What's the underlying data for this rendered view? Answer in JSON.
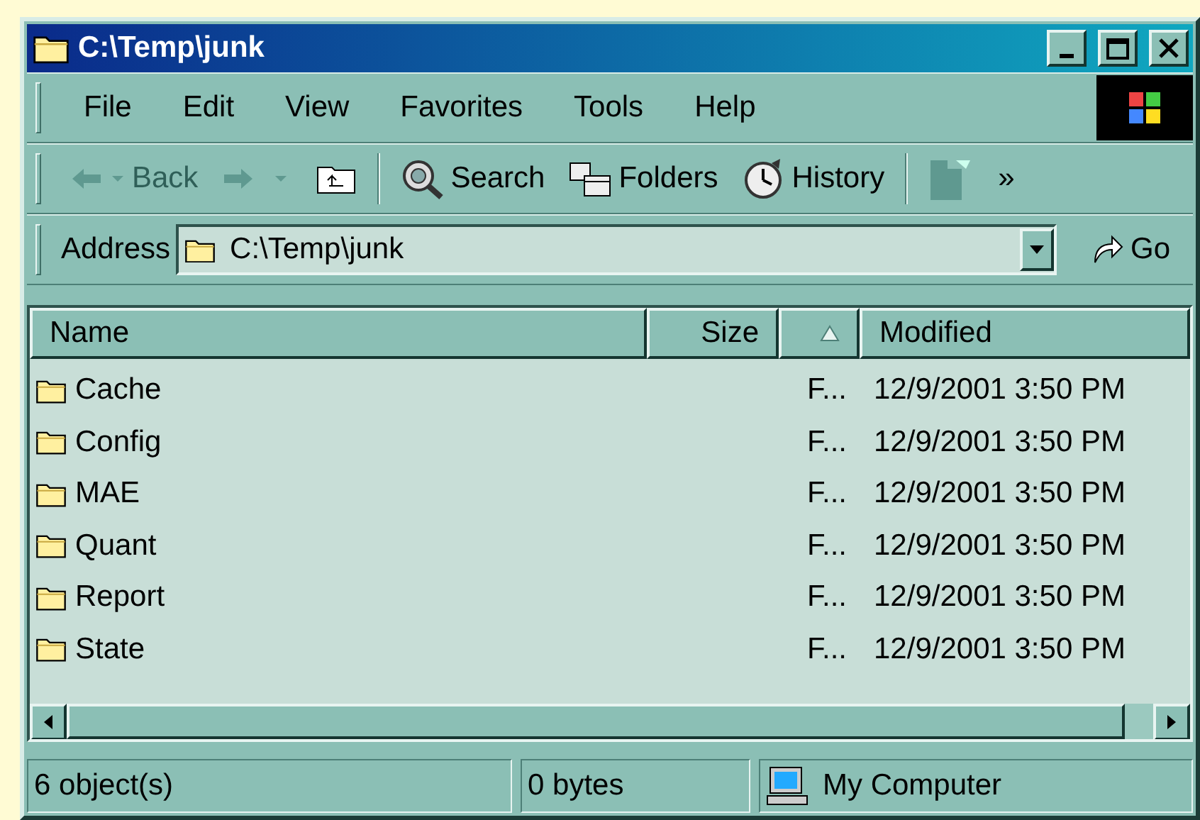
{
  "window": {
    "title": "C:\\Temp\\junk"
  },
  "menu": [
    "File",
    "Edit",
    "View",
    "Favorites",
    "Tools",
    "Help"
  ],
  "toolbar": [
    {
      "kind": "back",
      "label": "Back",
      "disabled": true
    },
    {
      "kind": "forward",
      "disabled": true
    },
    {
      "kind": "up"
    },
    {
      "kind": "search",
      "label": "Search"
    },
    {
      "kind": "folders",
      "label": "Folders"
    },
    {
      "kind": "history",
      "label": "History"
    },
    {
      "kind": "move"
    },
    {
      "kind": "more",
      "label": "»"
    }
  ],
  "address": {
    "label": "Address",
    "value": "C:\\Temp\\junk",
    "go": "Go"
  },
  "columns": [
    {
      "label": "Name",
      "sorted": false
    },
    {
      "label": "Size",
      "sorted": false
    },
    {
      "sorted": true
    },
    {
      "label": "Modified",
      "sorted": false
    }
  ],
  "rows": [
    {
      "name": "Cache",
      "type": "F...",
      "modified": "12/9/2001 3:50 PM"
    },
    {
      "name": "Config",
      "type": "F...",
      "modified": "12/9/2001 3:50 PM"
    },
    {
      "name": "MAE",
      "type": "F...",
      "modified": "12/9/2001 3:50 PM"
    },
    {
      "name": "Quant",
      "type": "F...",
      "modified": "12/9/2001 3:50 PM"
    },
    {
      "name": "Report",
      "type": "F...",
      "modified": "12/9/2001 3:50 PM"
    },
    {
      "name": "State",
      "type": "F...",
      "modified": "12/9/2001 3:50 PM"
    }
  ],
  "status_bar": {
    "objects": "6 object(s)",
    "size": "0 bytes",
    "zone": "My Computer"
  }
}
